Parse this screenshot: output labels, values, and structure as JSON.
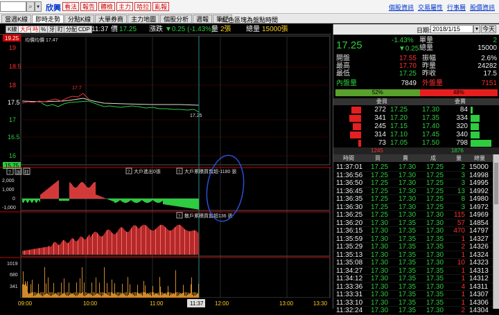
{
  "symbol": {
    "code": "",
    "name": "欣興"
  },
  "quick_buttons": [
    "看法",
    "報告",
    "體檢",
    "主力",
    "哈拉",
    "亂報"
  ],
  "top_links": [
    "個股資訊",
    "交易屬性",
    "行事曆",
    "股價資訊"
  ],
  "tabs": [
    "當週K線",
    "即時走勢",
    "分點K線",
    "大單券商",
    "主力地圖",
    "個股分析",
    "週報",
    "筆記"
  ],
  "chart_title": "紅色區塊為盤點時間",
  "toolbar": {
    "buttons": [
      "K線",
      "大戶",
      "時",
      "%",
      "牙",
      "盯",
      "分配",
      "CDP"
    ],
    "time": "11:37",
    "price_label": "價",
    "price": "17.25",
    "chg_label": "漲跌",
    "chg": "▼0.25 (-1.43%)",
    "vol_label": "量",
    "vol": "2張",
    "tvol_label": "總量",
    "tvol": "15000張"
  },
  "chart": {
    "price_axis": [
      "19.25",
      "19",
      "18.5",
      "18",
      "17.5",
      "17",
      "16.5",
      "16",
      "15.75"
    ],
    "avg_label": "均價均價 17.47",
    "high_label": "17.7",
    "low_label": "17.25",
    "mid_label": "17.5",
    "panel2_icons": [
      "?",
      "說",
      "柱"
    ],
    "panel2_labels": [
      "大戶進出0張",
      "大戶累積買賣超-1180 張"
    ],
    "panel2_axis": [
      "2,000",
      "1,000",
      "0",
      "-1,000"
    ],
    "panel3_label": "散戶累積買賣超136 張",
    "panel4_axis": [
      "1019",
      "680",
      "341"
    ],
    "time_axis": [
      "09:00",
      "10:00",
      "11:00",
      "11:37",
      "12:00",
      "13:00",
      "13:30"
    ]
  },
  "right": {
    "date_label": "日期:",
    "date": "2018/1/15",
    "date_btn": "今天",
    "price": "17.25",
    "pct": "-1.43%",
    "chg": "▼0.25",
    "quote": [
      {
        "k": "單量",
        "v": "2",
        "k2": "",
        "v2": ""
      },
      {
        "k": "總量",
        "v": "15000",
        "k2": "",
        "v2": ""
      },
      {
        "k": "開盤",
        "v": "17.55",
        "k2": "振幅",
        "v2": "2.6%"
      },
      {
        "k": "最高",
        "v": "17.70",
        "k2": "昨量",
        "v2": "24282"
      },
      {
        "k": "最低",
        "v": "17.25",
        "k2": "昨收",
        "v2": "17.5"
      },
      {
        "k": "內盤量",
        "v": "7849",
        "k2": "外盤量",
        "v2": "7151"
      }
    ],
    "ratio": {
      "buy": "52%",
      "sell": "48%",
      "buy_frac": 0.52
    },
    "ob_head": [
      "委買",
      "",
      "委賣"
    ],
    "orderbook": [
      {
        "bq": "272",
        "bp": "17.25",
        "ap": "17.30",
        "aq": "84",
        "bfrac": 0.34,
        "afrac": 0.1
      },
      {
        "bq": "341",
        "bp": "17.20",
        "ap": "17.35",
        "aq": "334",
        "bfrac": 0.43,
        "afrac": 0.42
      },
      {
        "bq": "245",
        "bp": "17.15",
        "ap": "17.40",
        "aq": "320",
        "bfrac": 0.31,
        "afrac": 0.4
      },
      {
        "bq": "314",
        "bp": "17.10",
        "ap": "17.45",
        "aq": "340",
        "bfrac": 0.39,
        "afrac": 0.43
      },
      {
        "bq": "73",
        "bp": "17.05",
        "ap": "17.50",
        "aq": "798",
        "bfrac": 0.09,
        "afrac": 1.0
      }
    ],
    "totals": {
      "bid": "1245",
      "ask": "1876"
    },
    "tt_head": [
      "時間",
      "買",
      "賣",
      "成",
      "量",
      "總量"
    ],
    "trades": [
      {
        "t": "11:37:01",
        "b": "17.25",
        "s": "17.30",
        "p": "17.25",
        "q": "2",
        "v": "15000"
      },
      {
        "t": "11:36:56",
        "b": "17.25",
        "s": "17.30",
        "p": "17.25",
        "q": "3",
        "v": "14998"
      },
      {
        "t": "11:36:50",
        "b": "17.25",
        "s": "17.30",
        "p": "17.25",
        "q": "3",
        "v": "14995"
      },
      {
        "t": "11:36:45",
        "b": "17.25",
        "s": "17.30",
        "p": "17.25",
        "q": "13",
        "v": "14992"
      },
      {
        "t": "11:36:35",
        "b": "17.25",
        "s": "17.30",
        "p": "17.25",
        "q": "8",
        "v": "14980"
      },
      {
        "t": "11:36:30",
        "b": "17.25",
        "s": "17.30",
        "p": "17.25",
        "q": "3",
        "v": "14972"
      },
      {
        "t": "11:36:25",
        "b": "17.25",
        "s": "17.30",
        "p": "17.30",
        "q": "115",
        "v": "14969"
      },
      {
        "t": "11:36:20",
        "b": "17.30",
        "s": "17.35",
        "p": "17.30",
        "q": "57",
        "v": "14854"
      },
      {
        "t": "11:36:15",
        "b": "17.30",
        "s": "17.35",
        "p": "17.30",
        "q": "470",
        "v": "14797"
      },
      {
        "t": "11:35:59",
        "b": "17.30",
        "s": "17.35",
        "p": "17.35",
        "q": "1",
        "v": "14327"
      },
      {
        "t": "11:35:29",
        "b": "17.30",
        "s": "17.35",
        "p": "17.35",
        "q": "2",
        "v": "14326"
      },
      {
        "t": "11:35:13",
        "b": "17.30",
        "s": "17.35",
        "p": "17.30",
        "q": "1",
        "v": "14324"
      },
      {
        "t": "11:35:08",
        "b": "17.30",
        "s": "17.35",
        "p": "17.30",
        "q": "10",
        "v": "14323"
      },
      {
        "t": "11:34:27",
        "b": "17.30",
        "s": "17.35",
        "p": "17.35",
        "q": "1",
        "v": "14313"
      },
      {
        "t": "11:34:12",
        "b": "17.30",
        "s": "17.35",
        "p": "17.35",
        "q": "1",
        "v": "14312"
      },
      {
        "t": "11:33:36",
        "b": "17.30",
        "s": "17.35",
        "p": "17.30",
        "q": "4",
        "v": "14311"
      },
      {
        "t": "11:33:31",
        "b": "17.30",
        "s": "17.35",
        "p": "17.35",
        "q": "1",
        "v": "14307"
      },
      {
        "t": "11:33:10",
        "b": "17.30",
        "s": "17.35",
        "p": "17.35",
        "q": "1",
        "v": "14306"
      },
      {
        "t": "11:32:24",
        "b": "17.30",
        "s": "17.35",
        "p": "17.30",
        "q": "2",
        "v": "14304"
      }
    ]
  }
}
